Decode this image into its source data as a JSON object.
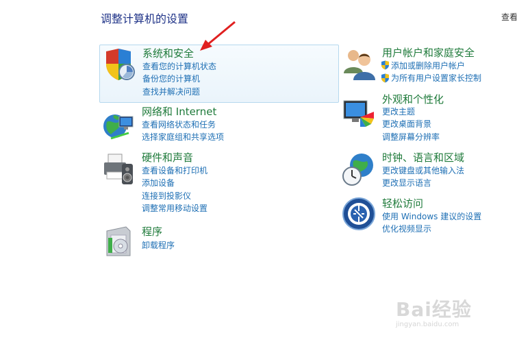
{
  "page": {
    "title": "调整计算机的设置",
    "view_by": "查看"
  },
  "categories": {
    "system_security": {
      "title": "系统和安全",
      "icon": "shield-icon",
      "links": [
        "查看您的计算机状态",
        "备份您的计算机",
        "查找并解决问题"
      ]
    },
    "network": {
      "title": "网络和 Internet",
      "icon": "network-globe-icon",
      "links": [
        "查看网络状态和任务",
        "选择家庭组和共享选项"
      ]
    },
    "hardware_sound": {
      "title": "硬件和声音",
      "icon": "printer-speaker-icon",
      "links": [
        "查看设备和打印机",
        "添加设备",
        "连接到投影仪",
        "调整常用移动设置"
      ]
    },
    "programs": {
      "title": "程序",
      "icon": "programs-box-icon",
      "links": [
        "卸载程序"
      ]
    },
    "user_accounts": {
      "title": "用户帐户和家庭安全",
      "icon": "users-icon",
      "links": [
        "添加或删除用户帐户",
        "为所有用户设置家长控制"
      ]
    },
    "appearance": {
      "title": "外观和个性化",
      "icon": "monitor-palette-icon",
      "links": [
        "更改主题",
        "更改桌面背景",
        "调整屏幕分辨率"
      ]
    },
    "clock_region": {
      "title": "时钟、语言和区域",
      "icon": "clock-globe-icon",
      "links": [
        "更改键盘或其他输入法",
        "更改显示语言"
      ]
    },
    "ease_access": {
      "title": "轻松访问",
      "icon": "ease-of-access-icon",
      "links": [
        "使用 Windows 建议的设置",
        "优化视频显示"
      ]
    }
  },
  "watermark": {
    "brand": "Bai经验",
    "url": "jingyan.baidu.com"
  },
  "colors": {
    "title": "#1e3287",
    "category": "#1e7a3a",
    "link": "#1e6fb4",
    "highlight_border": "#b5d8ee",
    "arrow": "#e02020"
  }
}
